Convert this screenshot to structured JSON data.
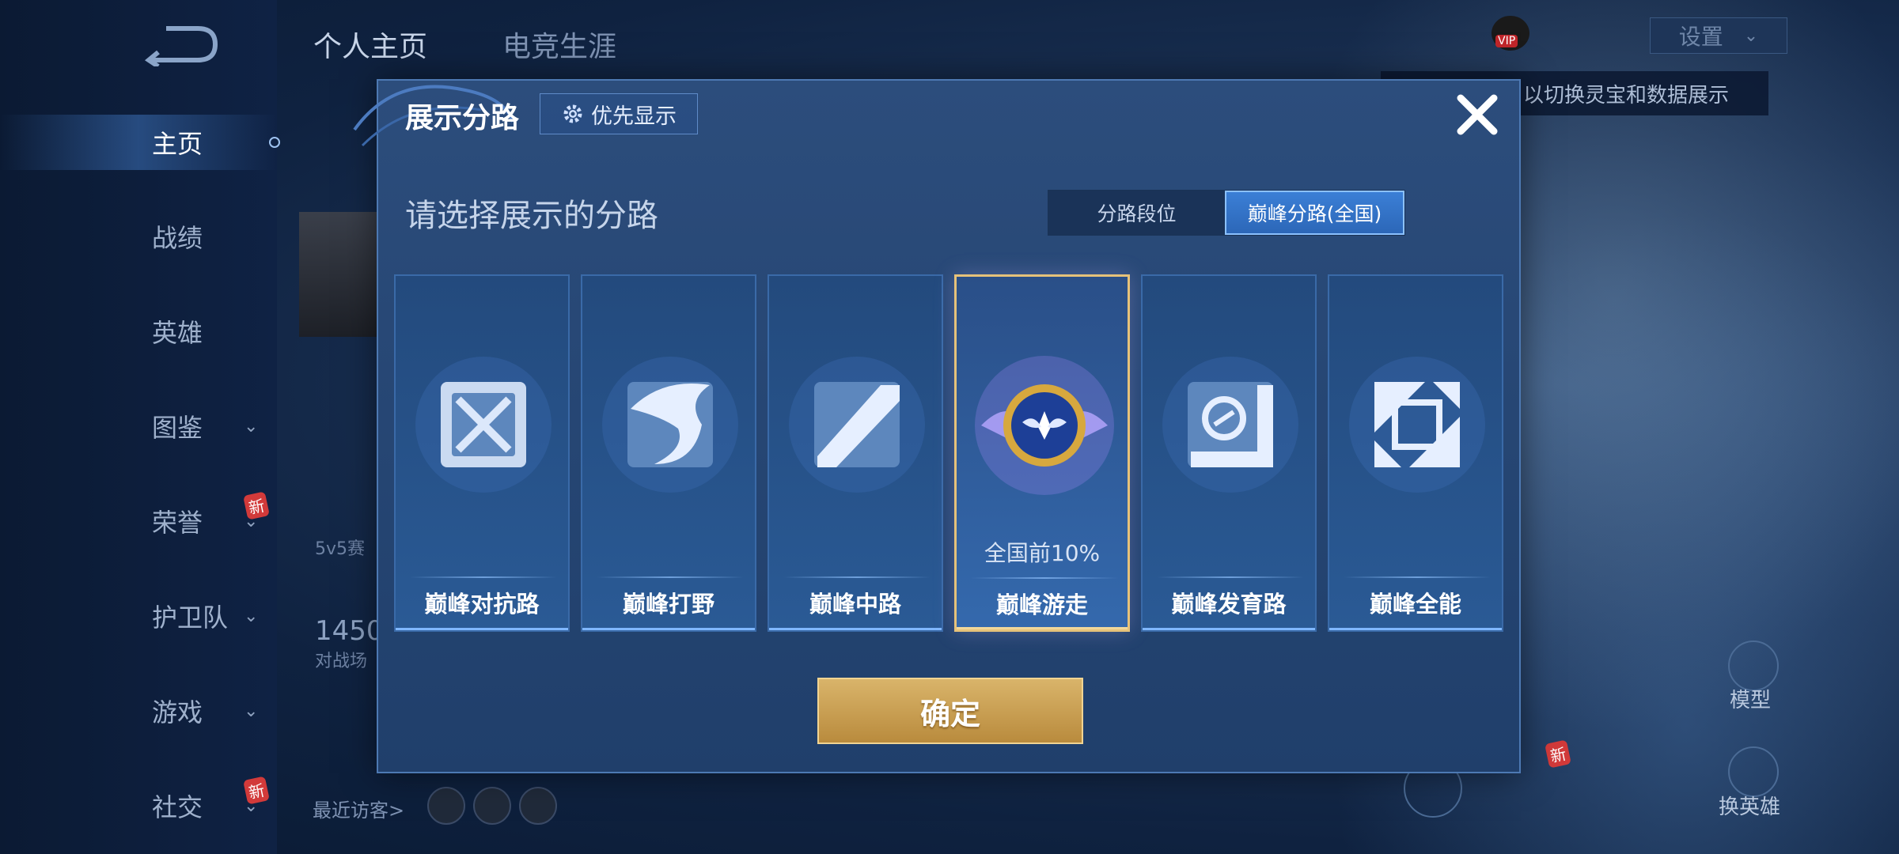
{
  "nav": {
    "items": [
      {
        "label": "主页",
        "active": true
      },
      {
        "label": "战绩"
      },
      {
        "label": "英雄"
      },
      {
        "label": "图鉴",
        "chevron": true
      },
      {
        "label": "荣誉",
        "chevron": true,
        "badge": "新"
      },
      {
        "label": "护卫队",
        "chevron": true
      },
      {
        "label": "游戏",
        "chevron": true
      },
      {
        "label": "社交",
        "chevron": true,
        "badge": "新"
      }
    ]
  },
  "header": {
    "tabs": [
      "个人主页",
      "电竞生涯"
    ],
    "settings_label": "设置",
    "tip_text": "以切换灵宝和数据展示",
    "vip_tag": "VIP"
  },
  "background_content": {
    "stat_mode": "5v5赛",
    "stat_number": "1450",
    "stat_caption": "对战场",
    "visitors_label": "最近访客>",
    "model_label": "模型",
    "switch_hero_label": "换英雄",
    "new_badge": "新"
  },
  "dialog": {
    "title": "展示分路",
    "priority_button": "优先显示",
    "subtitle": "请选择展示的分路",
    "segments": [
      {
        "label": "分路段位",
        "active": false
      },
      {
        "label": "巅峰分路(全国)",
        "active": true
      }
    ],
    "cards": [
      {
        "name": "巅峰对抗路",
        "icon": "sword-cross-icon",
        "selected": false
      },
      {
        "name": "巅峰打野",
        "icon": "dragon-icon",
        "selected": false
      },
      {
        "name": "巅峰中路",
        "icon": "slash-icon",
        "selected": false
      },
      {
        "name": "巅峰游走",
        "icon": "wings-emblem-icon",
        "selected": true,
        "rank": "全国前10%"
      },
      {
        "name": "巅峰发育路",
        "icon": "circle-s-icon",
        "selected": false
      },
      {
        "name": "巅峰全能",
        "icon": "four-corners-icon",
        "selected": false
      }
    ],
    "confirm_button": "确定"
  },
  "colors": {
    "accent_gold": "#e6c27a",
    "accent_blue": "#3b7fd6",
    "dialog_bg": "#2c4d7c"
  }
}
